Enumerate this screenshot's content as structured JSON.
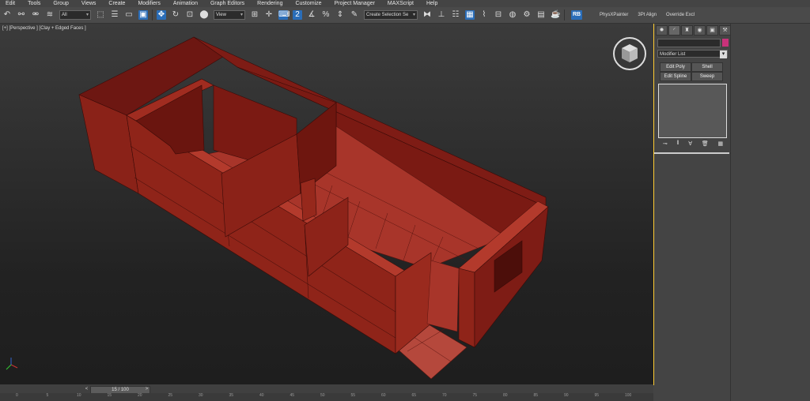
{
  "menu": [
    "Edit",
    "Tools",
    "Group",
    "Views",
    "Create",
    "Modifiers",
    "Animation",
    "Graph Editors",
    "Rendering",
    "Customize",
    "Project Manager",
    "MAXScript",
    "Help"
  ],
  "toolbar": {
    "filter_value": "All",
    "refcoord_value": "View",
    "selection_set_value": "Create Selection Se",
    "rb_label": "RB",
    "plugins": [
      "PhysXPainter",
      "3Pt Align",
      "Override Excl"
    ]
  },
  "viewport": {
    "label": "[+] [Perspective ] [Clay + Edged Faces ]",
    "accent_color": "#ffcc33",
    "model_color": "#7d1a14"
  },
  "command_panel": {
    "modifier_list_label": "Modifier List",
    "buttons": [
      "Edit Poly",
      "Shell",
      "Edit Spline",
      "Sweep"
    ],
    "swatch_color": "#c8327a"
  },
  "timeline": {
    "slider_label": "15 / 100",
    "ticks": [
      "0",
      "5",
      "10",
      "15",
      "20",
      "25",
      "30",
      "35",
      "40",
      "45",
      "50",
      "55",
      "60",
      "65",
      "70",
      "75",
      "80",
      "85",
      "90",
      "95",
      "100"
    ]
  }
}
